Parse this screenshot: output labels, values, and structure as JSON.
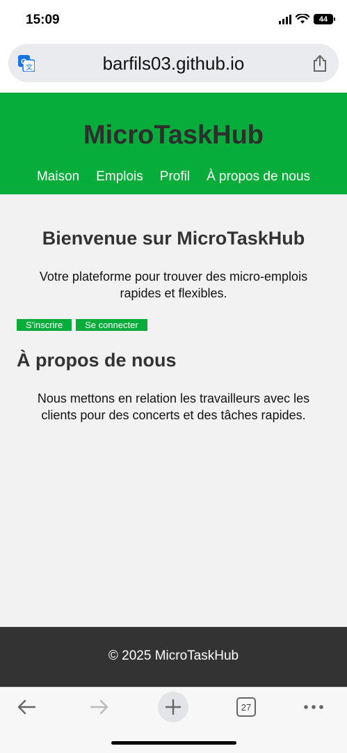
{
  "status_bar": {
    "time": "15:09",
    "battery": "44"
  },
  "browser": {
    "url": "barfils03.github.io",
    "tab_count": "27"
  },
  "site": {
    "title": "MicroTaskHub",
    "nav": [
      {
        "label": "Maison"
      },
      {
        "label": "Emplois"
      },
      {
        "label": "Profil"
      },
      {
        "label": "À propos de nous"
      }
    ]
  },
  "welcome": {
    "title": "Bienvenue sur MicroTaskHub",
    "text": "Votre plateforme pour trouver des micro-emplois rapides et flexibles.",
    "signup_label": "S'inscrire",
    "login_label": "Se connecter"
  },
  "about": {
    "title": "À propos de nous",
    "text": "Nous mettons en relation les travailleurs avec les clients pour des concerts et des tâches rapides."
  },
  "footer": {
    "text": "© 2025 MicroTaskHub"
  },
  "colors": {
    "brand_green": "#06ad3a",
    "footer_bg": "#333333",
    "main_bg": "#f2f2f2"
  }
}
